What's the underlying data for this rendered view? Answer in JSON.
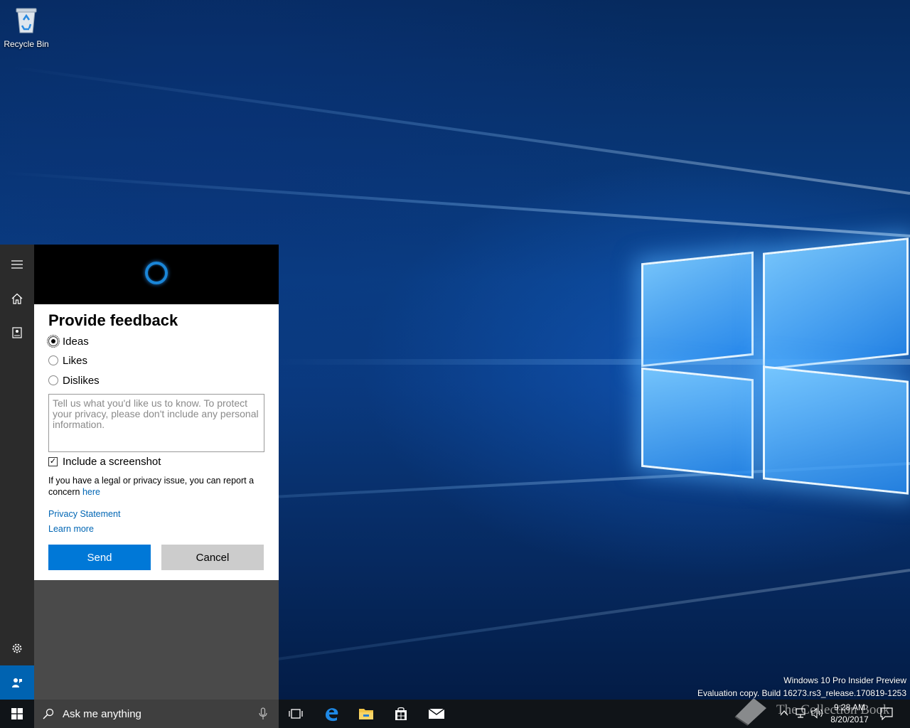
{
  "desktop": {
    "icons": [
      {
        "label": "Recycle Bin",
        "icon": "recycle-bin-icon"
      }
    ],
    "watermark": {
      "line1": "Windows 10 Pro Insider Preview",
      "line2": "Evaluation copy. Build 16273.rs3_release.170819-1253"
    },
    "overlay_logo_text": "The Collection Book"
  },
  "cortana": {
    "rail": [
      {
        "icon": "hamburger-menu-icon"
      },
      {
        "icon": "home-icon"
      },
      {
        "icon": "notebook-icon"
      },
      {
        "icon": "gear-icon"
      },
      {
        "icon": "feedback-icon"
      }
    ],
    "feedback": {
      "title": "Provide feedback",
      "options": [
        {
          "label": "Ideas",
          "checked": true
        },
        {
          "label": "Likes",
          "checked": false
        },
        {
          "label": "Dislikes",
          "checked": false
        }
      ],
      "textarea_placeholder": "Tell us what you'd like us to know. To protect your privacy, please don't include any personal information.",
      "include_screenshot_label": "Include a screenshot",
      "include_screenshot_checked": true,
      "legal_text": "If you have a legal or privacy issue, you can report a concern",
      "legal_link": "here",
      "privacy_link": "Privacy Statement",
      "learn_more_link": "Learn more",
      "send_label": "Send",
      "cancel_label": "Cancel"
    }
  },
  "taskbar": {
    "search_placeholder": "Ask me anything",
    "apps": [
      "task-view-icon",
      "edge-icon",
      "file-explorer-icon",
      "store-icon",
      "mail-icon"
    ],
    "clock_time": "9:28 AM",
    "clock_date": "8/20/2017"
  },
  "colors": {
    "accent": "#0078d7",
    "rail_bg": "#2b2b2b",
    "taskbar_bg": "#101418",
    "search_bg": "#3f3f3f"
  }
}
